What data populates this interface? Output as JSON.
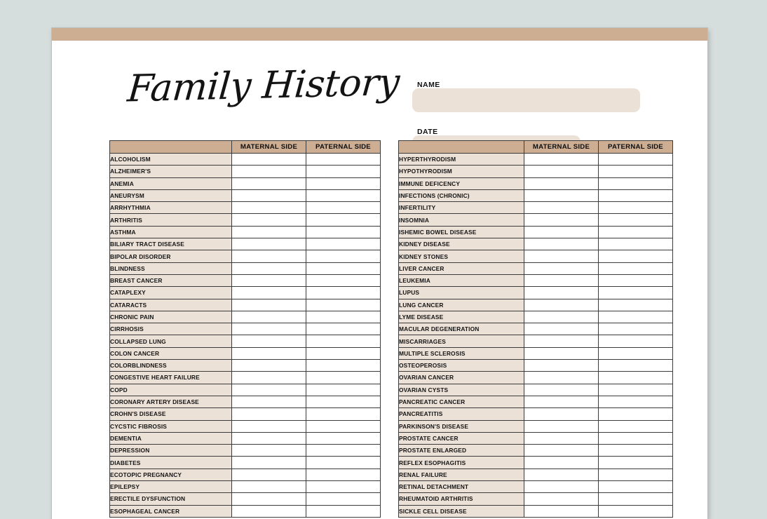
{
  "document": {
    "title": "Family History",
    "banner_color": "#cdae93",
    "page_background": "#ffffff",
    "canvas_background": "#d6dddd",
    "accent_color": "#cdae93",
    "row_label_color": "#ece1d7"
  },
  "form_fields": [
    {
      "label": "NAME",
      "value": "",
      "placeholder": ""
    },
    {
      "label": "DATE",
      "value": "",
      "placeholder": ""
    }
  ],
  "tables": {
    "columns": [
      "",
      "MATERNAL SIDE",
      "PATERNAL SIDE"
    ],
    "left": {
      "headers": [
        "",
        "MATERNAL SIDE",
        "PATERNAL SIDE"
      ],
      "rows": [
        "ALCOHOLISM",
        "ALZHEIMER'S",
        "ANEMIA",
        "ANEURYSM",
        "ARRHYTHMIA",
        "ARTHRITIS",
        "ASTHMA",
        "BILIARY TRACT DISEASE",
        "BIPOLAR DISORDER",
        "BLINDNESS",
        "BREAST CANCER",
        "CATAPLEXY",
        "CATARACTS",
        "CHRONIC PAIN",
        "CIRRHOSIS",
        "COLLAPSED LUNG",
        "COLON CANCER",
        "COLORBLINDNESS",
        "CONGESTIVE HEART FAILURE",
        "COPD",
        "CORONARY ARTERY DISEASE",
        "CROHN'S DISEASE",
        "CYCSTIC FIBROSIS",
        "DEMENTIA",
        "DEPRESSION",
        "DIABETES",
        "ECOTOPIC PREGNANCY",
        "EPILEPSY",
        "ERECTILE DYSFUNCTION",
        "ESOPHAGEAL CANCER"
      ]
    },
    "right": {
      "headers": [
        "",
        "MATERNAL SIDE",
        "PATERNAL SIDE"
      ],
      "rows": [
        "HYPERTHYRODISM",
        "HYPOTHYRODISM",
        "IMMUNE DEFICENCY",
        "INFECTIONS (CHRONIC)",
        "INFERTILITY",
        "INSOMNIA",
        "ISHEMIC BOWEL DISEASE",
        "KIDNEY DISEASE",
        "KIDNEY STONES",
        "LIVER CANCER",
        "LEUKEMIA",
        "LUPUS",
        "LUNG CANCER",
        "LYME DISEASE",
        "MACULAR DEGENERATION",
        "MISCARRIAGES",
        "MULTIPLE SCLEROSIS",
        "OSTEOPEROSIS",
        "OVARIAN CANCER",
        "OVARIAN CYSTS",
        "PANCREATIC CANCER",
        "PANCREATITIS",
        "PARKINSON'S DISEASE",
        "PROSTATE CANCER",
        "PROSTATE ENLARGED",
        "REFLEX ESOPHAGITIS",
        "RENAL FAILURE",
        "RETINAL DETACHMENT",
        "RHEUMATOID ARTHRITIS",
        "SICKLE CELL DISEASE"
      ]
    }
  }
}
